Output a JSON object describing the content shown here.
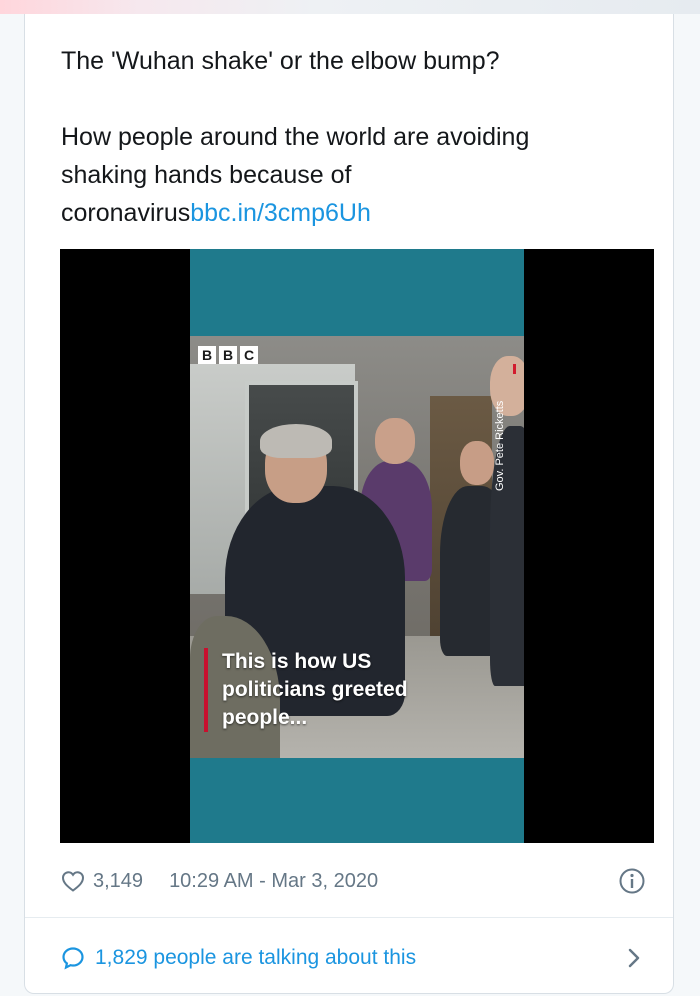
{
  "tweet": {
    "line1": "The 'Wuhan shake' or the elbow bump?",
    "line2": "How people around the world are avoiding",
    "line3": "shaking hands because of",
    "line4_text": "coronavirus",
    "link_text": "bbc.in/3cmp6Uh"
  },
  "video": {
    "logo_letters": [
      "B",
      "B",
      "C"
    ],
    "side_label": "Gov. Pete Ricketts",
    "caption_lines": [
      "This is how US",
      "politicians greeted",
      "people..."
    ],
    "accent_color": "#c8102e",
    "background_color": "#1f7a8c"
  },
  "meta": {
    "likes": "3,149",
    "timestamp": "10:29 AM - Mar 3, 2020",
    "like_icon": "heart-icon",
    "info_icon": "info-icon"
  },
  "footer": {
    "talk_text": "1,829 people are talking about this",
    "bubble_icon": "speech-bubble-icon",
    "chevron_icon": "chevron-right-icon"
  },
  "colors": {
    "link": "#1b95e0",
    "text": "#14171a",
    "muted": "#657786"
  }
}
